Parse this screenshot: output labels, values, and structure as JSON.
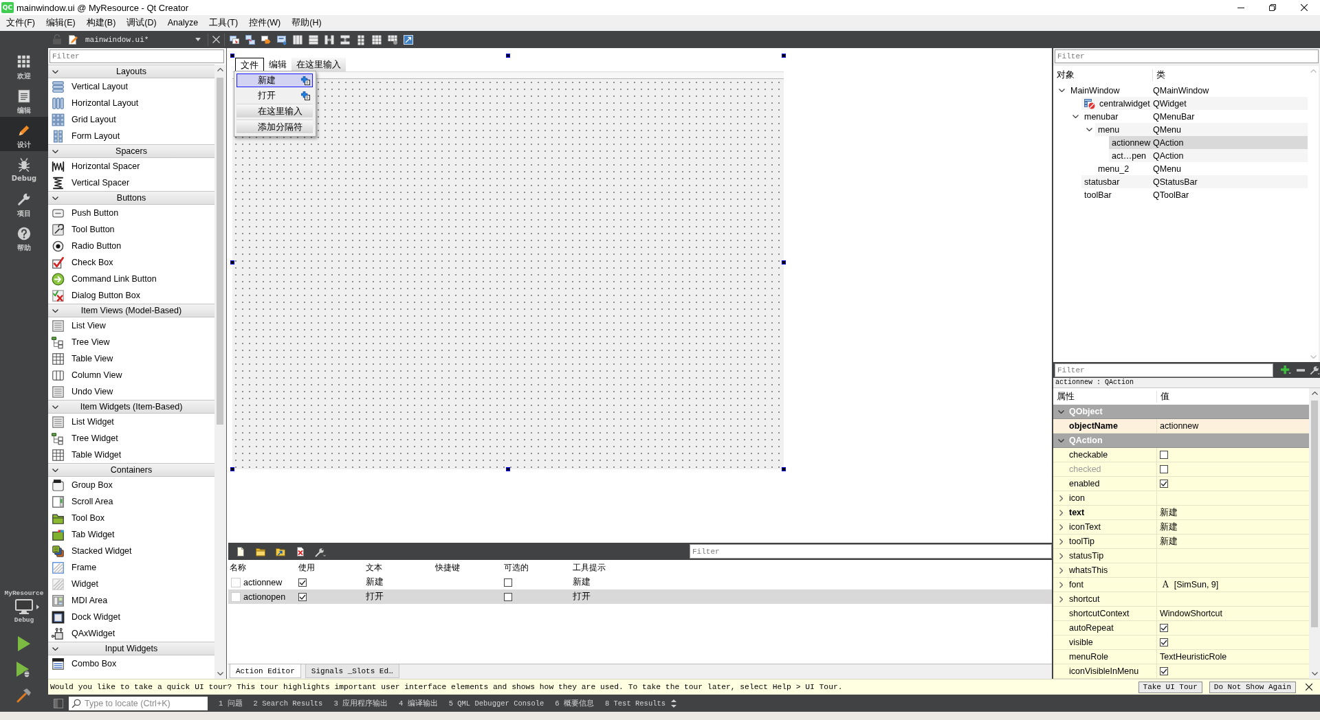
{
  "window": {
    "logo": "QC",
    "title": "mainwindow.ui @ MyResource - Qt Creator"
  },
  "menu_bar": [
    "文件(F)",
    "编辑(E)",
    "构建(B)",
    "调试(D)",
    "Analyze",
    "工具(T)",
    "控件(W)",
    "帮助(H)"
  ],
  "editor_toolbar": {
    "document": "mainwindow.ui*"
  },
  "mode_bar": {
    "modes": [
      {
        "kind": "welcome",
        "label": "欢迎",
        "selected": false
      },
      {
        "kind": "edit",
        "label": "编辑",
        "selected": false
      },
      {
        "kind": "design",
        "label": "设计",
        "selected": true
      },
      {
        "kind": "debug",
        "label": "Debug",
        "selected": false
      },
      {
        "kind": "projects",
        "label": "项目",
        "selected": false
      },
      {
        "kind": "help",
        "label": "帮助",
        "selected": false
      }
    ],
    "kit": {
      "project": "MyResource",
      "configuration": "Debug"
    }
  },
  "widget_box": {
    "filter_placeholder": "Filter",
    "categories": [
      {
        "name": "Layouts",
        "expanded": true,
        "items": [
          {
            "label": "Vertical Layout",
            "kind": "vlayout"
          },
          {
            "label": "Horizontal Layout",
            "kind": "hlayout"
          },
          {
            "label": "Grid Layout",
            "kind": "grid"
          },
          {
            "label": "Form Layout",
            "kind": "form"
          }
        ]
      },
      {
        "name": "Spacers",
        "expanded": true,
        "items": [
          {
            "label": "Horizontal Spacer",
            "kind": "hspacer"
          },
          {
            "label": "Vertical Spacer",
            "kind": "vspacer"
          }
        ]
      },
      {
        "name": "Buttons",
        "expanded": true,
        "items": [
          {
            "label": "Push Button",
            "kind": "push"
          },
          {
            "label": "Tool Button",
            "kind": "tool"
          },
          {
            "label": "Radio Button",
            "kind": "radio"
          },
          {
            "label": "Check Box",
            "kind": "check"
          },
          {
            "label": "Command Link Button",
            "kind": "cmdlink"
          },
          {
            "label": "Dialog Button Box",
            "kind": "dialogbox"
          }
        ]
      },
      {
        "name": "Item Views (Model-Based)",
        "expanded": true,
        "items": [
          {
            "label": "List View",
            "kind": "list"
          },
          {
            "label": "Tree View",
            "kind": "tree"
          },
          {
            "label": "Table View",
            "kind": "table"
          },
          {
            "label": "Column View",
            "kind": "columns"
          },
          {
            "label": "Undo View",
            "kind": "undo"
          }
        ]
      },
      {
        "name": "Item Widgets (Item-Based)",
        "expanded": true,
        "items": [
          {
            "label": "List Widget",
            "kind": "list"
          },
          {
            "label": "Tree Widget",
            "kind": "tree"
          },
          {
            "label": "Table Widget",
            "kind": "table"
          }
        ]
      },
      {
        "name": "Containers",
        "expanded": true,
        "items": [
          {
            "label": "Group Box",
            "kind": "group"
          },
          {
            "label": "Scroll Area",
            "kind": "scroll"
          },
          {
            "label": "Tool Box",
            "kind": "toolbox"
          },
          {
            "label": "Tab Widget",
            "kind": "tabs"
          },
          {
            "label": "Stacked Widget",
            "kind": "stacked"
          },
          {
            "label": "Frame",
            "kind": "frame"
          },
          {
            "label": "Widget",
            "kind": "widget"
          },
          {
            "label": "MDI Area",
            "kind": "mdi"
          },
          {
            "label": "Dock Widget",
            "kind": "dock"
          },
          {
            "label": "QAxWidget",
            "kind": "activex"
          }
        ]
      },
      {
        "name": "Input Widgets",
        "expanded": true,
        "items": [
          {
            "label": "Combo Box",
            "kind": "combo"
          }
        ]
      }
    ]
  },
  "form": {
    "menus": [
      {
        "label": "文件",
        "kind": "menu",
        "selected": true
      },
      {
        "label": "编辑",
        "kind": "menu",
        "selected": false
      },
      {
        "label": "在这里输入",
        "kind": "new",
        "selected": false
      }
    ],
    "menu_items": [
      {
        "label": "新建",
        "kind": "action",
        "selected": true
      },
      {
        "label": "打开",
        "kind": "action",
        "selected": false
      },
      {
        "label": "在这里输入",
        "kind": "new",
        "selected": false
      },
      {
        "label": "添加分隔符",
        "kind": "new",
        "selected": false
      }
    ]
  },
  "action_editor": {
    "filter_placeholder": "Filter",
    "columns": [
      "名称",
      "使用",
      "文本",
      "快捷键",
      "可选的",
      "工具提示"
    ],
    "rows": [
      {
        "name": "actionnew",
        "used": true,
        "text": "新建",
        "checkable": false,
        "tooltip": "新建",
        "selected": false
      },
      {
        "name": "actionopen",
        "used": true,
        "text": "打开",
        "checkable": false,
        "tooltip": "打开",
        "selected": true
      }
    ],
    "tabs": [
      {
        "label": "Action Editor",
        "selected": true
      },
      {
        "label": "Signals _Slots Ed…",
        "selected": false
      }
    ]
  },
  "object_inspector": {
    "filter_placeholder": "Filter",
    "columns": [
      "对象",
      "类"
    ],
    "tree": [
      {
        "name": "MainWindow",
        "class": "QMainWindow",
        "no_layout": false,
        "selected": false,
        "expanded": true,
        "children": [
          {
            "name": "centralwidget",
            "class": "QWidget",
            "no_layout": true,
            "selected": false
          },
          {
            "name": "menubar",
            "class": "QMenuBar",
            "no_layout": false,
            "selected": false,
            "expanded": true,
            "children": [
              {
                "name": "menu",
                "class": "QMenu",
                "no_layout": false,
                "selected": false,
                "expanded": true,
                "children": [
                  {
                    "name": "actionnew",
                    "class": "QAction",
                    "no_layout": false,
                    "selected": true
                  },
                  {
                    "name": "act…pen",
                    "class": "QAction",
                    "no_layout": false,
                    "selected": false
                  }
                ]
              },
              {
                "name": "menu_2",
                "class": "QMenu",
                "no_layout": false,
                "selected": false
              }
            ]
          },
          {
            "name": "statusbar",
            "class": "QStatusBar",
            "no_layout": false,
            "selected": false
          },
          {
            "name": "toolBar",
            "class": "QToolBar",
            "no_layout": false,
            "selected": false
          }
        ]
      }
    ]
  },
  "property_editor": {
    "filter_placeholder": "Filter",
    "object_label": "actionnew : QAction",
    "columns": [
      "属性",
      "值"
    ],
    "groups": [
      {
        "name": "QObject",
        "expanded": true,
        "color": "#fdf0dc",
        "properties": [
          {
            "name": "objectName",
            "kind": "text",
            "value": "actionnew",
            "modified": true,
            "disabled": false
          }
        ]
      },
      {
        "name": "QAction",
        "expanded": true,
        "color": "#fefedb",
        "properties": [
          {
            "name": "checkable",
            "kind": "bool",
            "checked": false,
            "modified": false,
            "disabled": false
          },
          {
            "name": "checked",
            "kind": "bool",
            "checked": false,
            "modified": false,
            "disabled": true
          },
          {
            "name": "enabled",
            "kind": "bool",
            "checked": true,
            "modified": false,
            "disabled": false
          },
          {
            "name": "icon",
            "kind": "text",
            "expanded": false,
            "modified": false,
            "disabled": false
          },
          {
            "name": "text",
            "kind": "text",
            "value": "新建",
            "expanded": false,
            "modified": true,
            "disabled": false
          },
          {
            "name": "iconText",
            "kind": "text",
            "value": "新建",
            "expanded": false,
            "modified": false,
            "disabled": false
          },
          {
            "name": "toolTip",
            "kind": "text",
            "value": "新建",
            "expanded": false,
            "modified": false,
            "disabled": false
          },
          {
            "name": "statusTip",
            "kind": "text",
            "expanded": false,
            "modified": false,
            "disabled": false
          },
          {
            "name": "whatsThis",
            "kind": "text",
            "expanded": false,
            "modified": false,
            "disabled": false
          },
          {
            "name": "font",
            "kind": "font",
            "sample": "A",
            "value": "[SimSun, 9]",
            "expanded": false,
            "modified": false,
            "disabled": false
          },
          {
            "name": "shortcut",
            "kind": "text",
            "expanded": false,
            "modified": false,
            "disabled": false
          },
          {
            "name": "shortcutContext",
            "kind": "text",
            "value": "WindowShortcut",
            "modified": false,
            "disabled": false
          },
          {
            "name": "autoRepeat",
            "kind": "bool",
            "checked": true,
            "modified": false,
            "disabled": false
          },
          {
            "name": "visible",
            "kind": "bool",
            "checked": true,
            "modified": false,
            "disabled": false
          },
          {
            "name": "menuRole",
            "kind": "text",
            "value": "TextHeuristicRole",
            "modified": false,
            "disabled": false
          },
          {
            "name": "iconVisibleInMenu",
            "kind": "bool",
            "checked": true,
            "modified": false,
            "disabled": false
          }
        ]
      }
    ]
  },
  "tour_bar": {
    "message": "Would you like to take a quick UI tour? This tour highlights important user interface elements and shows how they are used. To take the tour later, select Help > UI Tour.",
    "buttons": [
      "Take UI Tour",
      "Do Not Show Again"
    ]
  },
  "output_bar": {
    "locator_placeholder": "Type to locate (Ctrl+K)",
    "panes": [
      "1 问题",
      "2 Search Results",
      "3 应用程序输出",
      "4 编译输出",
      "5 QML Debugger Console",
      "6 概要信息",
      "8 Test Results"
    ]
  }
}
